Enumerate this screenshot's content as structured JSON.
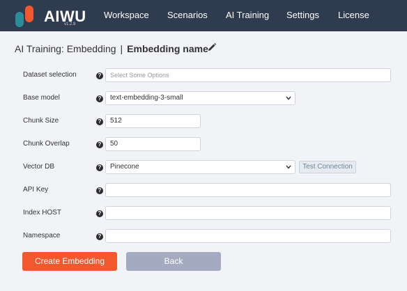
{
  "brand": {
    "name": "AIWU",
    "version": "v1.2.9"
  },
  "nav": {
    "items": [
      "Workspace",
      "Scenarios",
      "AI Training",
      "Settings",
      "License"
    ]
  },
  "breadcrumb": {
    "section": "AI Training: Embedding",
    "separator": "|",
    "name": "Embedding name"
  },
  "form": {
    "dataset": {
      "label": "Dataset selection",
      "placeholder": "Select Some Options"
    },
    "base_model": {
      "label": "Base model",
      "value": "text-embedding-3-small"
    },
    "chunk_size": {
      "label": "Chunk Size",
      "value": "512"
    },
    "chunk_overlap": {
      "label": "Chunk Overlap",
      "value": "50"
    },
    "vector_db": {
      "label": "Vector DB",
      "value": "Pinecone",
      "test_label": "Test Connection"
    },
    "api_key": {
      "label": "API Key",
      "value": ""
    },
    "index_host": {
      "label": "Index HOST",
      "value": ""
    },
    "namespace": {
      "label": "Namespace",
      "value": ""
    },
    "help_glyph": "?"
  },
  "actions": {
    "create_label": "Create Embedding",
    "back_label": "Back"
  },
  "colors": {
    "topbar": "#2f3b4e",
    "primary": "#f2572d",
    "secondary": "#a4abc1"
  }
}
